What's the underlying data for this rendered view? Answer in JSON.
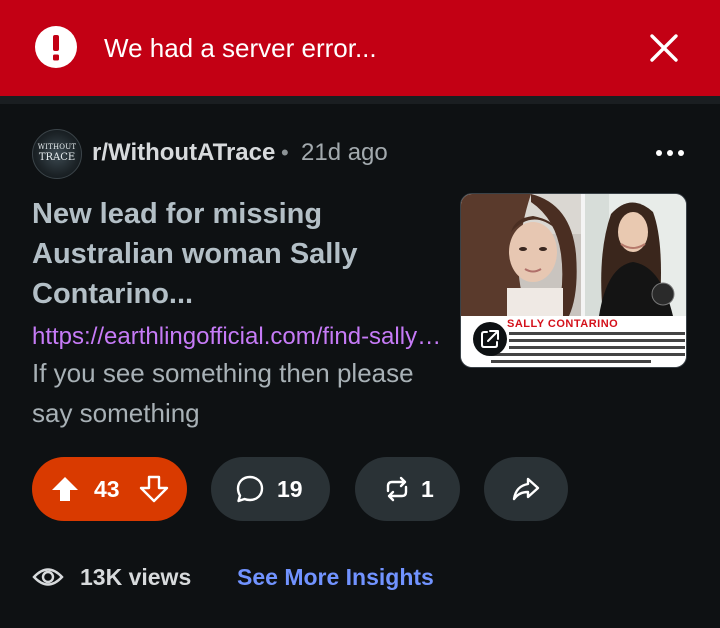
{
  "error_banner": {
    "message": "We had a server error...",
    "icon": "exclamation-circle-icon",
    "close_icon": "close-icon",
    "color": "#c30014"
  },
  "post": {
    "subreddit": "r/WithoutATrace",
    "separator": "•",
    "age": "21d ago",
    "avatar": {
      "line1": "WITHOUT",
      "line2": "TRACE"
    },
    "title": "New lead for missing Australian woman Sally Contarino...",
    "link": "https://earthlingofficial.com/find-sally-contarino",
    "body": "If you see something then please say something",
    "thumbnail": {
      "caption_title": "SALLY CONTARINO",
      "caption_lines": [
        "…, 34, WAS LAST HEARD FROM FAMILY ON",
        "…. SHE FAILED TO BOARD HER FLIGHT BACK",
        "…STRALIA THE NEXT DAY AND HAS NOT BEEN",
        "HEARD FROM SINCE. SHE VISITED MT. CHARLESTON,",
        "LAS VEGAS, AND SOUTHERN CALIFORNIA"
      ],
      "icon": "external-link-icon"
    }
  },
  "actions": {
    "upvotes": "43",
    "comments": "19",
    "crossposts": "1",
    "vote_color": "#d93a00",
    "pill_color": "#2a3236"
  },
  "insights": {
    "views": "13K views",
    "link_label": "See More Insights",
    "link_color": "#7193ff"
  }
}
